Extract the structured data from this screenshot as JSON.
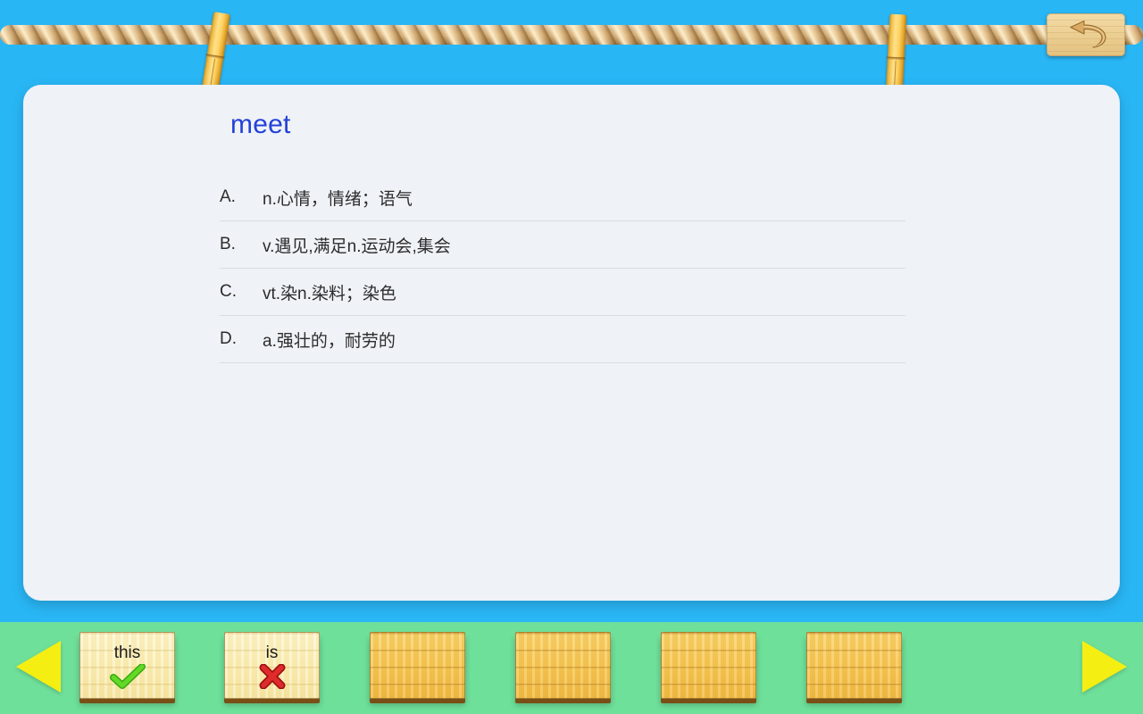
{
  "app": {
    "background_color": "#29b6f5",
    "bottom_bar_color": "#6ee09a",
    "accent_blue": "#2341d8",
    "arrow_color": "#f5ee12"
  },
  "header": {
    "back_button_label": "back-arrow",
    "rope_label": "clothesline-rope",
    "clothespin_left_label": "clothespin",
    "clothespin_right_label": "clothespin"
  },
  "quiz": {
    "word": "meet",
    "options": [
      {
        "letter": "A.",
        "text": "n.心情，情绪；语气"
      },
      {
        "letter": "B.",
        "text": "v.遇见,满足n.运动会,集会"
      },
      {
        "letter": "C.",
        "text": "vt.染n.染料；染色"
      },
      {
        "letter": "D.",
        "text": "a.强壮的，耐劳的"
      }
    ]
  },
  "bottom": {
    "prev_label": "previous",
    "next_label": "next",
    "cards": [
      {
        "label": "this",
        "mark": "check",
        "state": "filled",
        "mark_color": "#4cc417"
      },
      {
        "label": "is",
        "mark": "cross",
        "state": "filled",
        "mark_color": "#d62424"
      },
      {
        "label": "",
        "mark": "none",
        "state": "empty",
        "mark_color": ""
      },
      {
        "label": "",
        "mark": "none",
        "state": "empty",
        "mark_color": ""
      },
      {
        "label": "",
        "mark": "none",
        "state": "empty",
        "mark_color": ""
      },
      {
        "label": "",
        "mark": "none",
        "state": "empty",
        "mark_color": ""
      }
    ]
  }
}
